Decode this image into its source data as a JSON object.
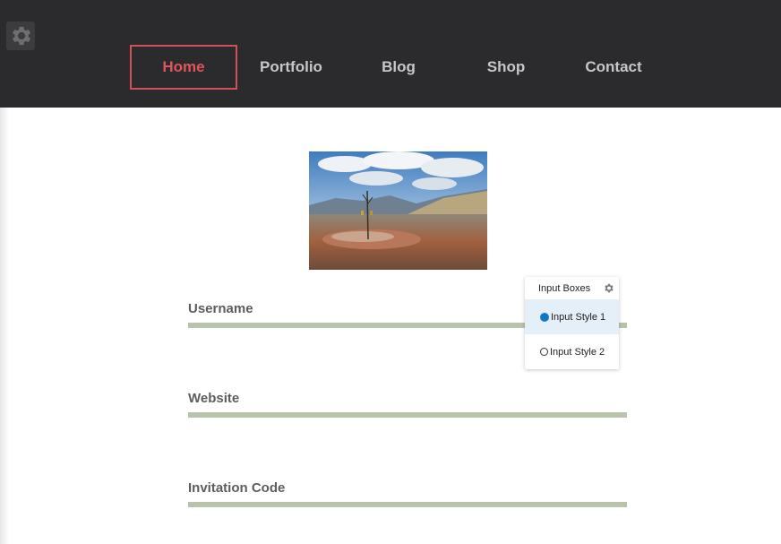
{
  "header": {
    "nav": [
      {
        "label": "Home",
        "active": true
      },
      {
        "label": "Portfolio",
        "active": false
      },
      {
        "label": "Blog",
        "active": false
      },
      {
        "label": "Shop",
        "active": false
      },
      {
        "label": "Contact",
        "active": false
      }
    ],
    "settings_icon": "gear-icon"
  },
  "hero": {
    "icon": "landscape-photo"
  },
  "form": {
    "fields": [
      {
        "label": "Username",
        "value": ""
      },
      {
        "label": "Website",
        "value": ""
      },
      {
        "label": "Invitation Code",
        "value": ""
      }
    ]
  },
  "popup": {
    "title": "Input Boxes",
    "options": [
      {
        "label": "Input Style 1",
        "selected": true
      },
      {
        "label": "Input Style 2",
        "selected": false
      }
    ]
  },
  "colors": {
    "header_bg": "#2b2a2c",
    "accent": "#e0545e",
    "input_line": "#b8c3ac",
    "radio_selected": "#1479c5"
  }
}
